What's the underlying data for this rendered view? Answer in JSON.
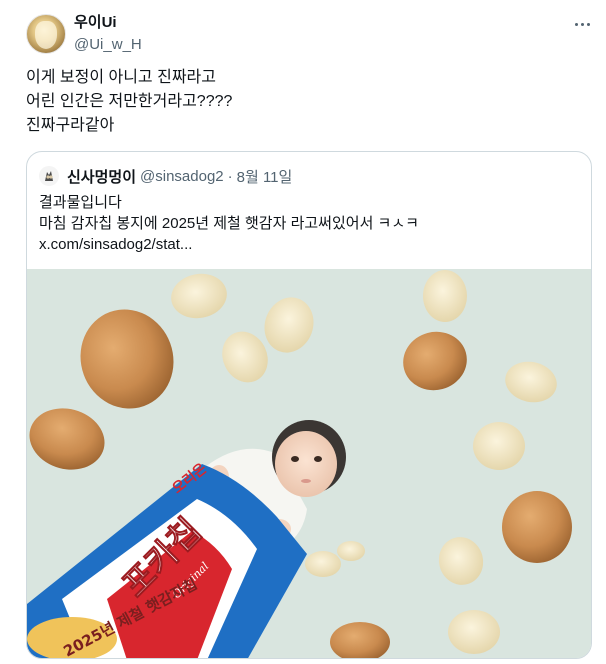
{
  "tweet": {
    "display_name": "우이Ui",
    "handle": "@Ui_w_H",
    "lines": [
      "이게 보정이 아니고 진짜라고",
      "어린 인간은 저만한거라고????",
      "진짜구라같아"
    ]
  },
  "quoted": {
    "display_name": "신사멍멍이",
    "handle": "@sinsadog2",
    "separator": "·",
    "date": "8월 11일",
    "lines": [
      "결과물입니다",
      "마침 감자칩 봉지에 2025년 제철 햇감자 라고써있어서 ㅋㅅㅋ",
      "x.com/sinsadog2/stat..."
    ]
  },
  "photo": {
    "bag_brand": "오리온",
    "bag_product": "포카칩",
    "bag_variant": "Original",
    "bag_tagline": "2025년 제철 햇감자칩",
    "colors": {
      "background": "#d9e5df",
      "potato": "#c98a4e",
      "chip": "#f1e7c8",
      "bag_blue": "#1f6fc4",
      "bag_red": "#d8262e"
    }
  }
}
